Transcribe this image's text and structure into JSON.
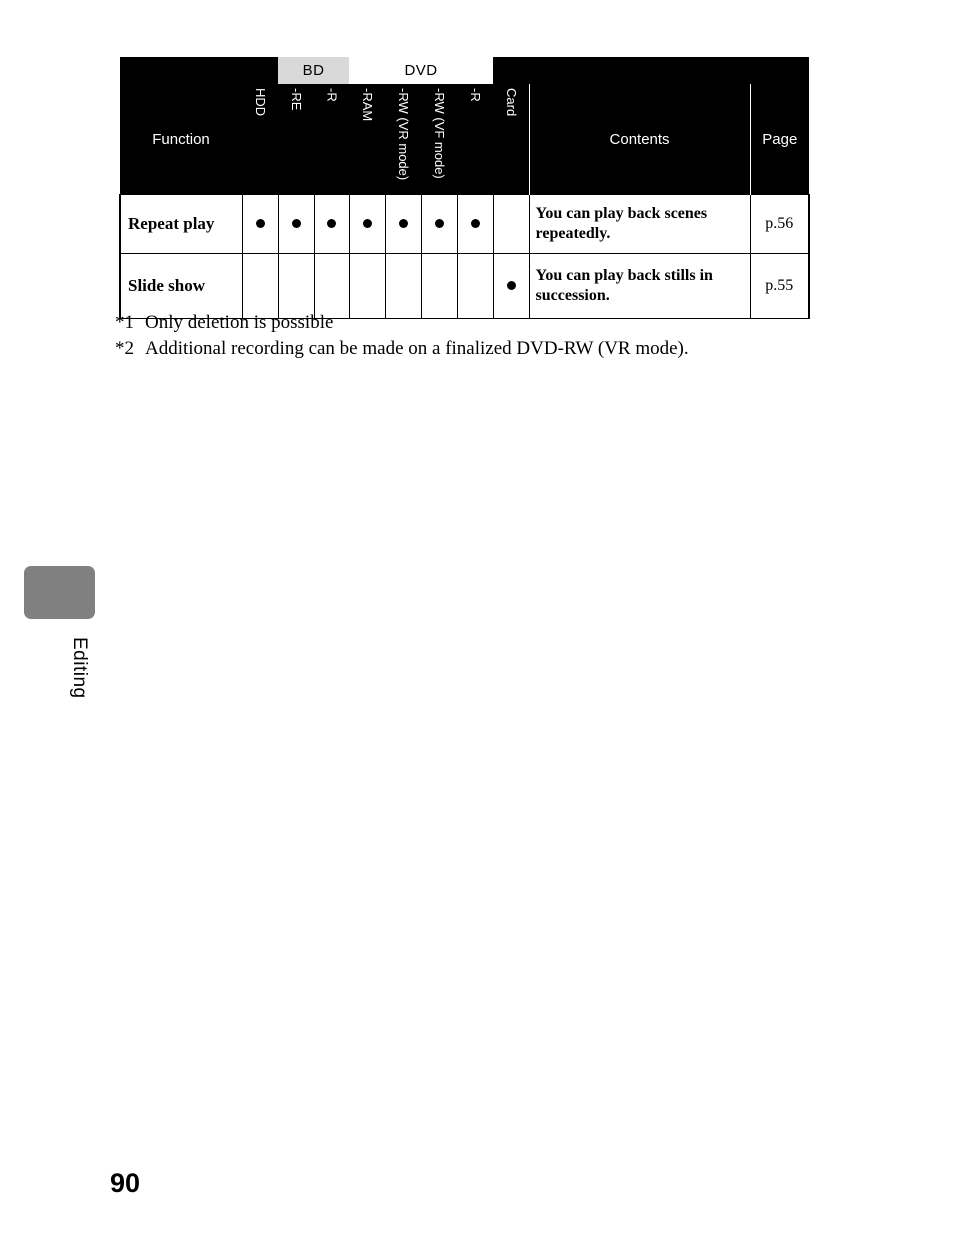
{
  "table": {
    "group_headers": [
      {
        "label": "",
        "span": 2,
        "style": "blank"
      },
      {
        "label": "BD",
        "span": 2,
        "style": "bd"
      },
      {
        "label": "DVD",
        "span": 4,
        "style": "dvd"
      },
      {
        "label": "",
        "span": 1,
        "style": "blank"
      },
      {
        "label": "",
        "span": 2,
        "style": "blank"
      }
    ],
    "columns": [
      {
        "key": "function",
        "label": "Function",
        "orient": "horizontal"
      },
      {
        "key": "hdd",
        "label": "HDD",
        "orient": "vertical"
      },
      {
        "key": "bd_re",
        "label": "-RE",
        "orient": "vertical"
      },
      {
        "key": "bd_r",
        "label": "-R",
        "orient": "vertical"
      },
      {
        "key": "dvd_ram",
        "label": "-RAM",
        "orient": "vertical"
      },
      {
        "key": "dvd_rw_vr",
        "label": "-RW (VR mode)",
        "orient": "vertical"
      },
      {
        "key": "dvd_rw_vf",
        "label": "-RW (VF mode)",
        "orient": "vertical"
      },
      {
        "key": "dvd_r",
        "label": "-R",
        "orient": "vertical"
      },
      {
        "key": "card",
        "label": "Card",
        "orient": "vertical"
      },
      {
        "key": "contents",
        "label": "Contents",
        "orient": "horizontal"
      },
      {
        "key": "page",
        "label": "Page",
        "orient": "horizontal"
      }
    ],
    "rows": [
      {
        "function": "Repeat play",
        "marks": [
          true,
          true,
          true,
          true,
          true,
          true,
          true,
          false
        ],
        "contents": "You can play back scenes repeatedly.",
        "page": "p.56"
      },
      {
        "function": "Slide show",
        "marks": [
          false,
          false,
          false,
          false,
          false,
          false,
          false,
          true
        ],
        "contents": "You can play back stills in succession.",
        "page": "p.55"
      }
    ]
  },
  "footnotes": [
    {
      "mark": "*1",
      "text": "Only deletion is possible"
    },
    {
      "mark": "*2",
      "text": "Additional recording can be made on a finalized DVD-RW (VR mode)."
    }
  ],
  "sidebar": {
    "chapter_label": "Editing",
    "tab_color": "#808080"
  },
  "page_number": "90"
}
